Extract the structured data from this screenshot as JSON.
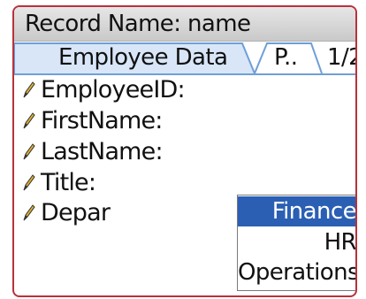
{
  "title_bar": {
    "text": "Record Name: name"
  },
  "tabs": [
    {
      "label": "Employee Data",
      "active": true
    },
    {
      "label": "P..",
      "active": false
    }
  ],
  "tab_page_indicator": "1/2",
  "fields": [
    {
      "label": "EmployeeID:",
      "icon": "pencil-icon"
    },
    {
      "label": "FirstName:",
      "icon": "pencil-icon"
    },
    {
      "label": "LastName:",
      "icon": "pencil-icon"
    },
    {
      "label": "Title:",
      "icon": "pencil-icon"
    },
    {
      "label": "Depar",
      "icon": "pencil-icon"
    }
  ],
  "department_dropdown": {
    "options": [
      "Finance",
      "HR",
      "Operations"
    ],
    "selected": "Finance"
  },
  "colors": {
    "frame_border": "#b8323c",
    "selection": "#2b5fb4",
    "tab_accent": "#6f9fd8"
  }
}
